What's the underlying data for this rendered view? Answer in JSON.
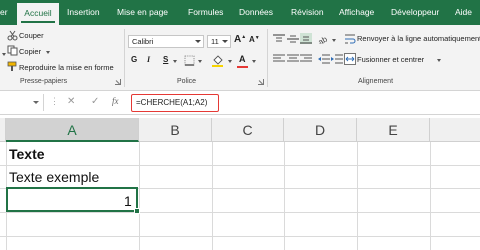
{
  "tabs": {
    "file": "er",
    "home": "Accueil",
    "insert": "Insertion",
    "layout": "Mise en page",
    "formulas": "Formules",
    "data": "Données",
    "review": "Révision",
    "view": "Affichage",
    "developer": "Développeur",
    "help": "Aide"
  },
  "clipboard": {
    "cut_label": "Couper",
    "copy_label": "Copier",
    "format_painter_label": "Reproduire la mise en forme",
    "group_label": "Presse-papiers"
  },
  "font": {
    "font_name": "Calibri",
    "font_size": "11",
    "bold": "G",
    "italic": "I",
    "underline": "S",
    "grow": "A",
    "shrink": "A",
    "group_label": "Police"
  },
  "alignment": {
    "wrap_text_label": "Renvoyer à la ligne automatiquement",
    "merge_center_label": "Fusionner et centrer",
    "group_label": "Alignement"
  },
  "formula_bar": {
    "fx_label": "fx",
    "formula": "=CHERCHE(A1;A2)"
  },
  "grid": {
    "columns": [
      "A",
      "B",
      "C",
      "D",
      "E"
    ],
    "active_column": "A",
    "cells": {
      "a1": "Texte",
      "a2": "Texte exemple",
      "a3": "1"
    }
  },
  "colors": {
    "accent": "#217346",
    "formula_highlight": "#e53935",
    "font_color_bar": "#e53935",
    "fill_color_bar": "#f7d400"
  }
}
